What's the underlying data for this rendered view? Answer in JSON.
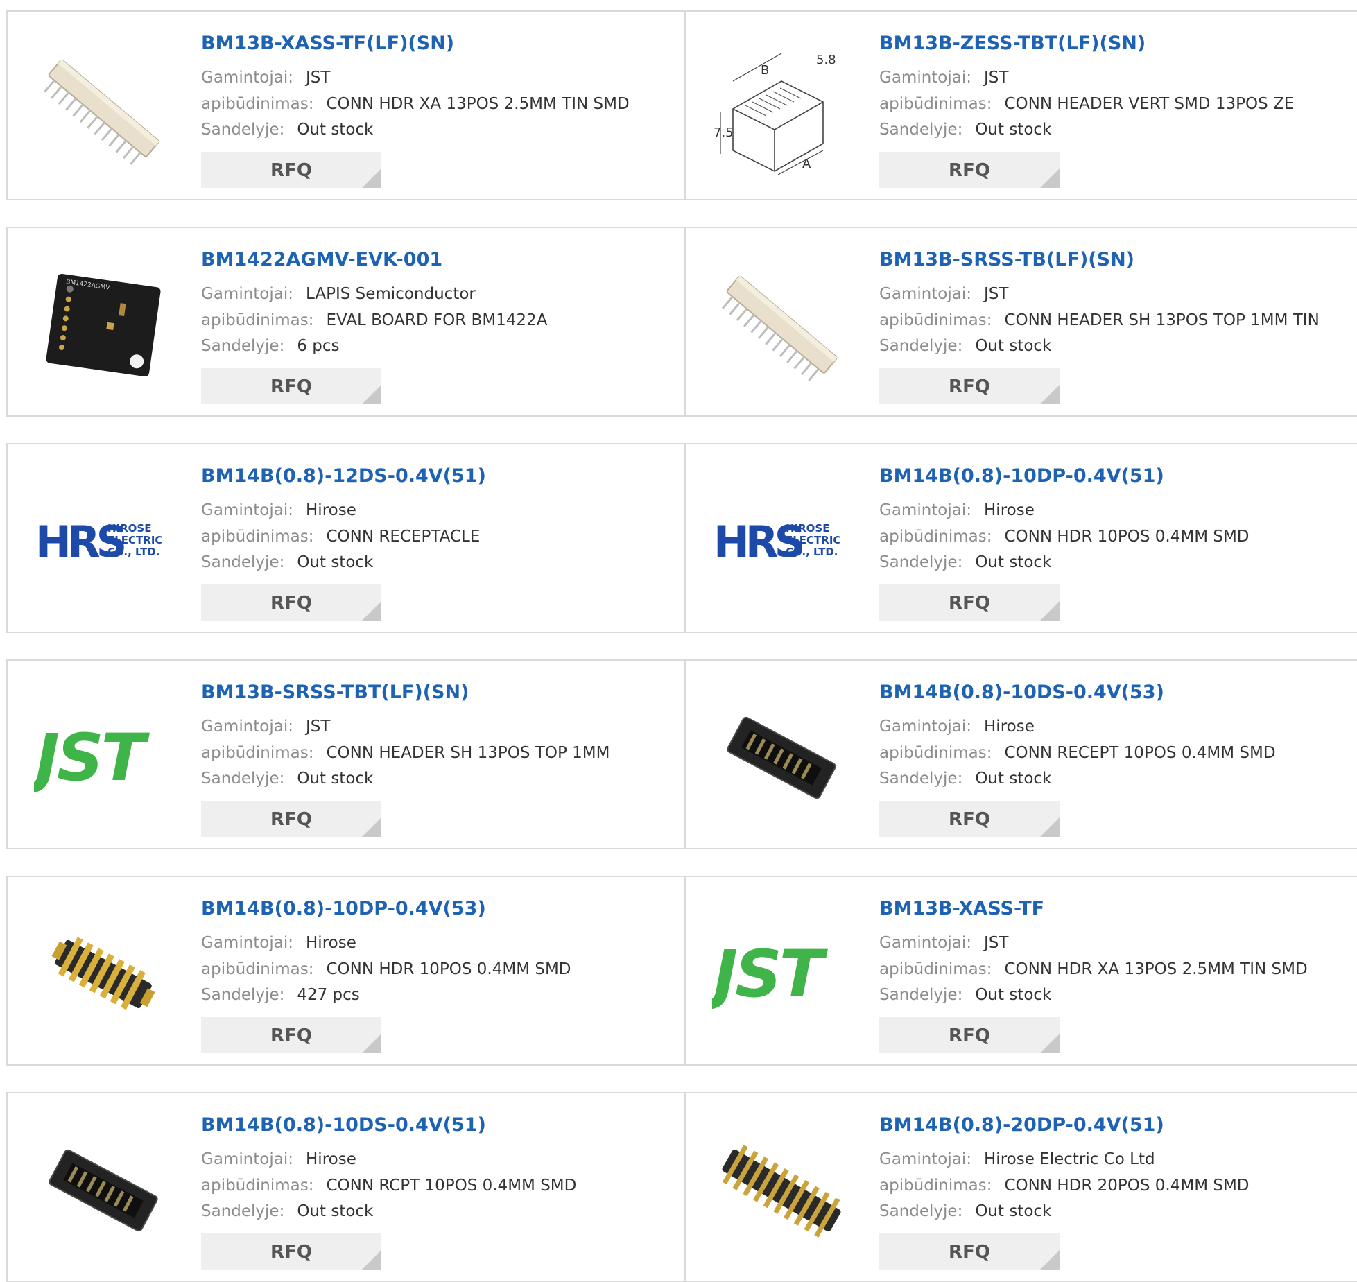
{
  "labels": {
    "manufacturer": "Gamintojai:",
    "description": "apibūdinimas:",
    "stock": "Sandelyje:",
    "rfq": "RFQ"
  },
  "colors": {
    "title_link": "#1e63b3",
    "label_gray": "#8c8c8c",
    "rfq_bg": "#efefef",
    "jst_green": "#3fb549",
    "hrs_blue": "#1d4aa8"
  },
  "products": [
    {
      "part": "BM13B-XASS-TF(LF)(SN)",
      "manufacturer": "JST",
      "description": "CONN HDR XA 13POS 2.5MM TIN SMD",
      "stock": "Out stock",
      "image": "white-header-angled"
    },
    {
      "part": "BM13B-ZESS-TBT(LF)(SN)",
      "manufacturer": "JST",
      "description": "CONN HEADER VERT SMD 13POS ZE",
      "stock": "Out stock",
      "image": "drawing-ze-header",
      "drawing_labels": [
        "B",
        "5.8",
        "7.5",
        "A"
      ]
    },
    {
      "part": "BM1422AGMV-EVK-001",
      "manufacturer": "LAPIS Semiconductor",
      "description": "EVAL BOARD FOR BM1422A",
      "stock": "6 pcs",
      "image": "eval-board",
      "board_label": "BM1422AGMV"
    },
    {
      "part": "BM13B-SRSS-TB(LF)(SN)",
      "manufacturer": "JST",
      "description": "CONN HEADER SH 13POS TOP 1MM TIN",
      "stock": "Out stock",
      "image": "white-header-angled"
    },
    {
      "part": "BM14B(0.8)-12DS-0.4V(51)",
      "manufacturer": "Hirose",
      "description": "CONN RECEPTACLE",
      "stock": "Out stock",
      "image": "hrs-logo",
      "logo_text": [
        "HRS",
        "HIROSE",
        "ELECTRIC",
        "CO., LTD."
      ]
    },
    {
      "part": "BM14B(0.8)-10DP-0.4V(51)",
      "manufacturer": "Hirose",
      "description": "CONN HDR 10POS 0.4MM SMD",
      "stock": "Out stock",
      "image": "hrs-logo",
      "logo_text": [
        "HRS",
        "HIROSE",
        "ELECTRIC",
        "CO., LTD."
      ]
    },
    {
      "part": "BM13B-SRSS-TBT(LF)(SN)",
      "manufacturer": "JST",
      "description": "CONN HEADER SH 13POS TOP 1MM",
      "stock": "Out stock",
      "image": "jst-logo",
      "logo_text": [
        "JST"
      ]
    },
    {
      "part": "BM14B(0.8)-10DS-0.4V(53)",
      "manufacturer": "Hirose",
      "description": "CONN RECEPT 10POS 0.4MM SMD",
      "stock": "Out stock",
      "image": "black-connector"
    },
    {
      "part": "BM14B(0.8)-10DP-0.4V(53)",
      "manufacturer": "Hirose",
      "description": "CONN HDR 10POS 0.4MM SMD",
      "stock": "427 pcs",
      "image": "gold-connector"
    },
    {
      "part": "BM13B-XASS-TF",
      "manufacturer": "JST",
      "description": "CONN HDR XA 13POS 2.5MM TIN SMD",
      "stock": "Out stock",
      "image": "jst-logo",
      "logo_text": [
        "JST"
      ]
    },
    {
      "part": "BM14B(0.8)-10DS-0.4V(51)",
      "manufacturer": "Hirose",
      "description": "CONN RCPT 10POS 0.4MM SMD",
      "stock": "Out stock",
      "image": "black-connector"
    },
    {
      "part": "BM14B(0.8)-20DP-0.4V(51)",
      "manufacturer": "Hirose Electric Co Ltd",
      "description": "CONN HDR 20POS 0.4MM SMD",
      "stock": "Out stock",
      "image": "gold-connector-long"
    }
  ]
}
